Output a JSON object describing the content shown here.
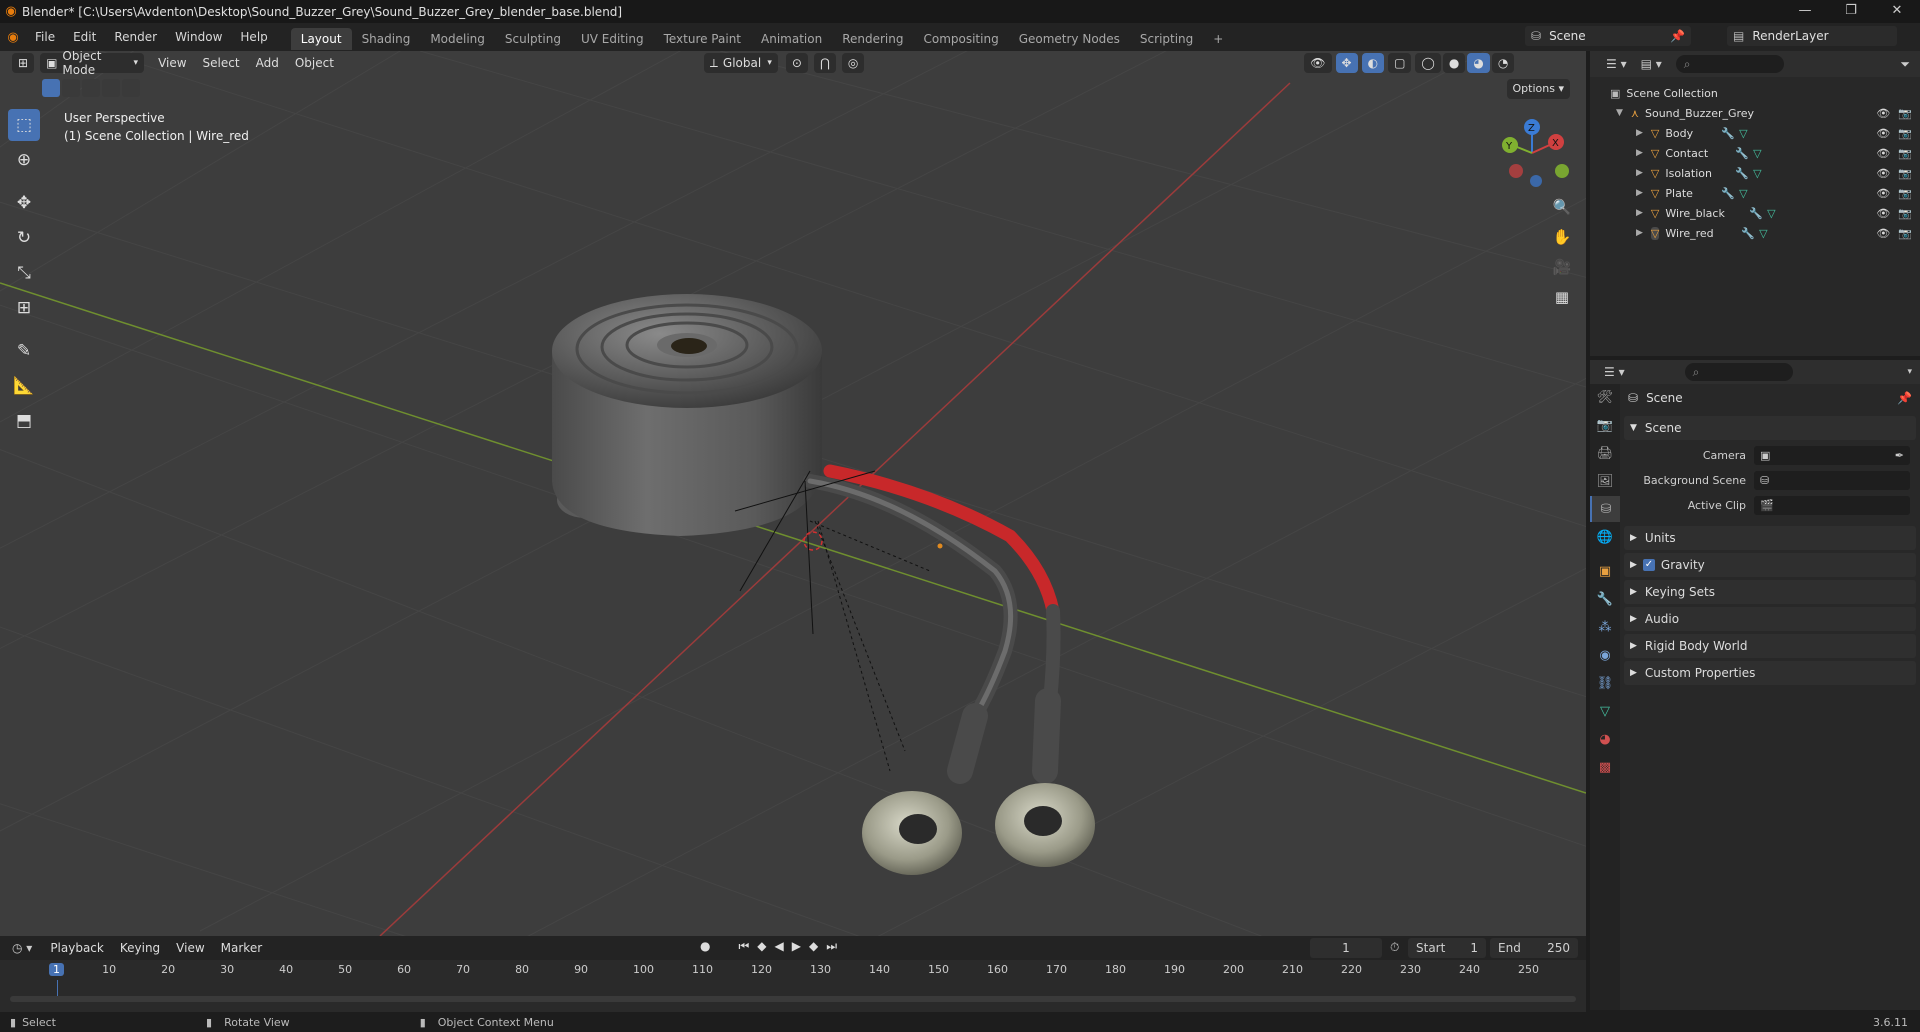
{
  "window": {
    "title": "Blender* [C:\\Users\\Avdenton\\Desktop\\Sound_Buzzer_Grey\\Sound_Buzzer_Grey_blender_base.blend]",
    "controls": [
      "—",
      "❐",
      "✕"
    ]
  },
  "menubar": {
    "items": [
      "File",
      "Edit",
      "Render",
      "Window",
      "Help"
    ]
  },
  "workspaces": {
    "tabs": [
      "Layout",
      "Shading",
      "Modeling",
      "Sculpting",
      "UV Editing",
      "Texture Paint",
      "Animation",
      "Rendering",
      "Compositing",
      "Geometry Nodes",
      "Scripting"
    ],
    "active": "Layout",
    "add": "+"
  },
  "scene_selector": {
    "scene": "Scene",
    "view_layer": "RenderLayer"
  },
  "viewport": {
    "mode": "Object Mode",
    "menus": [
      "View",
      "Select",
      "Add",
      "Object"
    ],
    "orientation": "Global",
    "options_label": "Options",
    "info_line1": "User Perspective",
    "info_line2": "(1) Scene Collection | Wire_red",
    "gizmo": {
      "x": "X",
      "y": "Y",
      "z": "Z"
    }
  },
  "outliner": {
    "root": "Scene Collection",
    "collection": "Sound_Buzzer_Grey",
    "objects": [
      "Body",
      "Contact",
      "Isolation",
      "Plate",
      "Wire_black",
      "Wire_red"
    ],
    "active_object": "Wire_red"
  },
  "properties": {
    "context_title": "Scene",
    "panel_scene": "Scene",
    "camera_label": "Camera",
    "background_scene_label": "Background Scene",
    "active_clip_label": "Active Clip",
    "camera_value": "",
    "background_scene_value": "",
    "active_clip_value": "",
    "collapsed_panels": [
      "Units",
      "Gravity",
      "Keying Sets",
      "Audio",
      "Rigid Body World",
      "Custom Properties"
    ],
    "gravity_enabled": true
  },
  "timeline": {
    "menus": [
      "Playback",
      "Keying",
      "View",
      "Marker"
    ],
    "current_frame": "1",
    "start_label": "Start",
    "start": "1",
    "end_label": "End",
    "end": "250",
    "ruler_ticks": [
      "1",
      "10",
      "20",
      "30",
      "40",
      "50",
      "60",
      "70",
      "80",
      "90",
      "100",
      "110",
      "120",
      "130",
      "140",
      "150",
      "160",
      "170",
      "180",
      "190",
      "200",
      "210",
      "220",
      "230",
      "240",
      "250"
    ]
  },
  "statusbar": {
    "select": "Select",
    "rotate": "Rotate View",
    "context": "Object Context Menu",
    "version": "3.6.11"
  },
  "colors": {
    "accent": "#4772b3",
    "x_axis": "#9b3b3b",
    "y_axis": "#6f8f2f",
    "wire_red": "#c8282a"
  }
}
